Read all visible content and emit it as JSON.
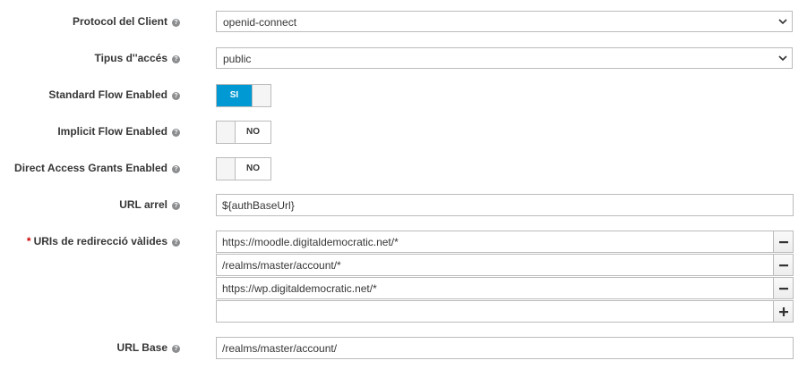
{
  "fields": {
    "protocol": {
      "label": "Protocol del Client",
      "value": "openid-connect"
    },
    "access_type": {
      "label": "Tipus d''accés",
      "value": "public"
    },
    "standard_flow": {
      "label": "Standard Flow Enabled",
      "state_label": "SI"
    },
    "implicit_flow": {
      "label": "Implicit Flow Enabled",
      "state_label": "NO"
    },
    "direct_access": {
      "label": "Direct Access Grants Enabled",
      "state_label": "NO"
    },
    "root_url": {
      "label": "URL arrel",
      "value": "${authBaseUrl}"
    },
    "redirect_uris": {
      "required_mark": "*",
      "label": "URIs de redirecció vàlides",
      "items": [
        "https://moodle.digitaldemocratic.net/*",
        "/realms/master/account/*",
        "https://wp.digitaldemocratic.net/*",
        ""
      ]
    },
    "base_url": {
      "label": "URL Base",
      "value": "/realms/master/account/"
    }
  },
  "icons": {
    "help": "question-circle-icon",
    "dropdown": "chevron-down-icon",
    "remove": "minus-icon",
    "add": "plus-icon"
  },
  "colors": {
    "toggle_on": "#0099d3",
    "required": "#cc0000"
  }
}
